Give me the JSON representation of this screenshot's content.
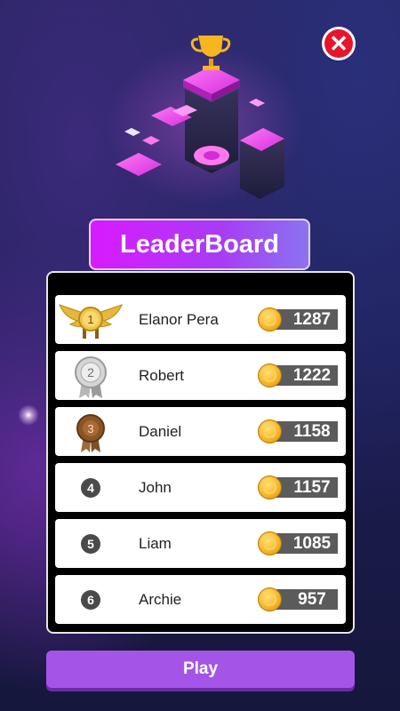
{
  "header": {
    "title": "LeaderBoard",
    "close_icon": "close-icon"
  },
  "leaderboard": {
    "rows": [
      {
        "rank": "1",
        "name": "Elanor Pera",
        "score": "1287",
        "badge": "gold-winged-medal-icon"
      },
      {
        "rank": "2",
        "name": "Robert",
        "score": "1222",
        "badge": "silver-medal-icon"
      },
      {
        "rank": "3",
        "name": "Daniel",
        "score": "1158",
        "badge": "bronze-medal-icon"
      },
      {
        "rank": "4",
        "name": "John",
        "score": "1157",
        "badge": "rank-number"
      },
      {
        "rank": "5",
        "name": "Liam",
        "score": "1085",
        "badge": "rank-number"
      },
      {
        "rank": "6",
        "name": "Archie",
        "score": "957",
        "badge": "rank-number"
      }
    ]
  },
  "footer": {
    "play_label": "Play"
  },
  "colors": {
    "title_banner": "#d91aff",
    "play_button": "#a455e8",
    "close_button": "#e8142a",
    "score_bg": "#5b5b5b",
    "coin": "#f6b82c"
  }
}
